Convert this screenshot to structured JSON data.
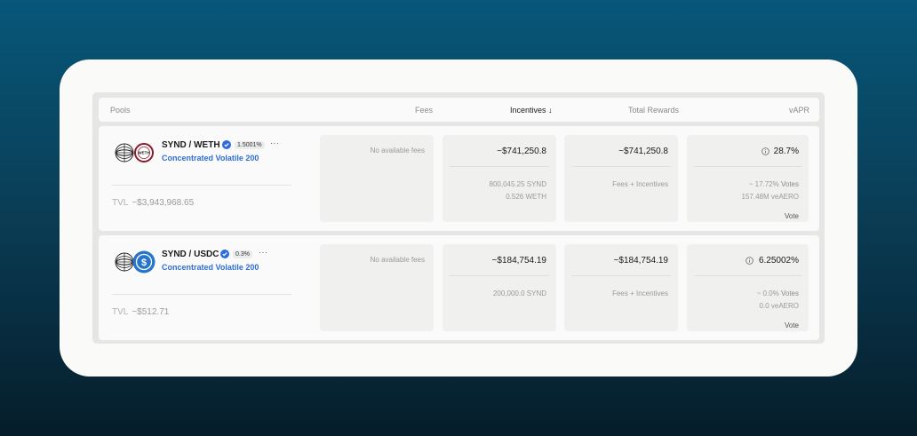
{
  "header": {
    "pools": "Pools",
    "fees": "Fees",
    "incentives": "Incentives ↓",
    "total_rewards": "Total Rewards",
    "vapr": "vAPR"
  },
  "rows": [
    {
      "pair": "SYND / WETH",
      "fee_badge": "1.5001%",
      "more": "···",
      "pool_type": "Concentrated Volatile 200",
      "tvl_label": "TVL",
      "tvl_value": "~$3,943,968.65",
      "fees": "No available fees",
      "incentives_total": "~$741,250.8",
      "incentives_line1": "800,045.25 SYND",
      "incentives_line2": "0.526 WETH",
      "total_rewards": "~$741,250.8",
      "total_rewards_note": "Fees + Incentives",
      "vapr": "28.7%",
      "votes_pct": "~ 17.72%",
      "votes_label": "Votes",
      "votes_amount": "157.48M veAERO",
      "vote": "Vote",
      "token_b_icon": "weth-icon"
    },
    {
      "pair": "SYND / USDC",
      "fee_badge": "0.3%",
      "more": "···",
      "pool_type": "Concentrated Volatile 200",
      "tvl_label": "TVL",
      "tvl_value": "~$512.71",
      "fees": "No available fees",
      "incentives_total": "~$184,754.19",
      "incentives_line1": "200,000.0 SYND",
      "incentives_line2": "",
      "total_rewards": "~$184,754.19",
      "total_rewards_note": "Fees + Incentives",
      "vapr": "6.25002%",
      "votes_pct": "~ 0.0%",
      "votes_label": "Votes",
      "votes_amount": "0.0 veAERO",
      "vote": "Vote",
      "token_b_icon": "usdc-icon"
    }
  ],
  "colors": {
    "accent_blue": "#2f6fd6",
    "verified_blue": "#2d6be0",
    "usdc_blue": "#2775ca",
    "weth_red": "#8b1a2b"
  }
}
